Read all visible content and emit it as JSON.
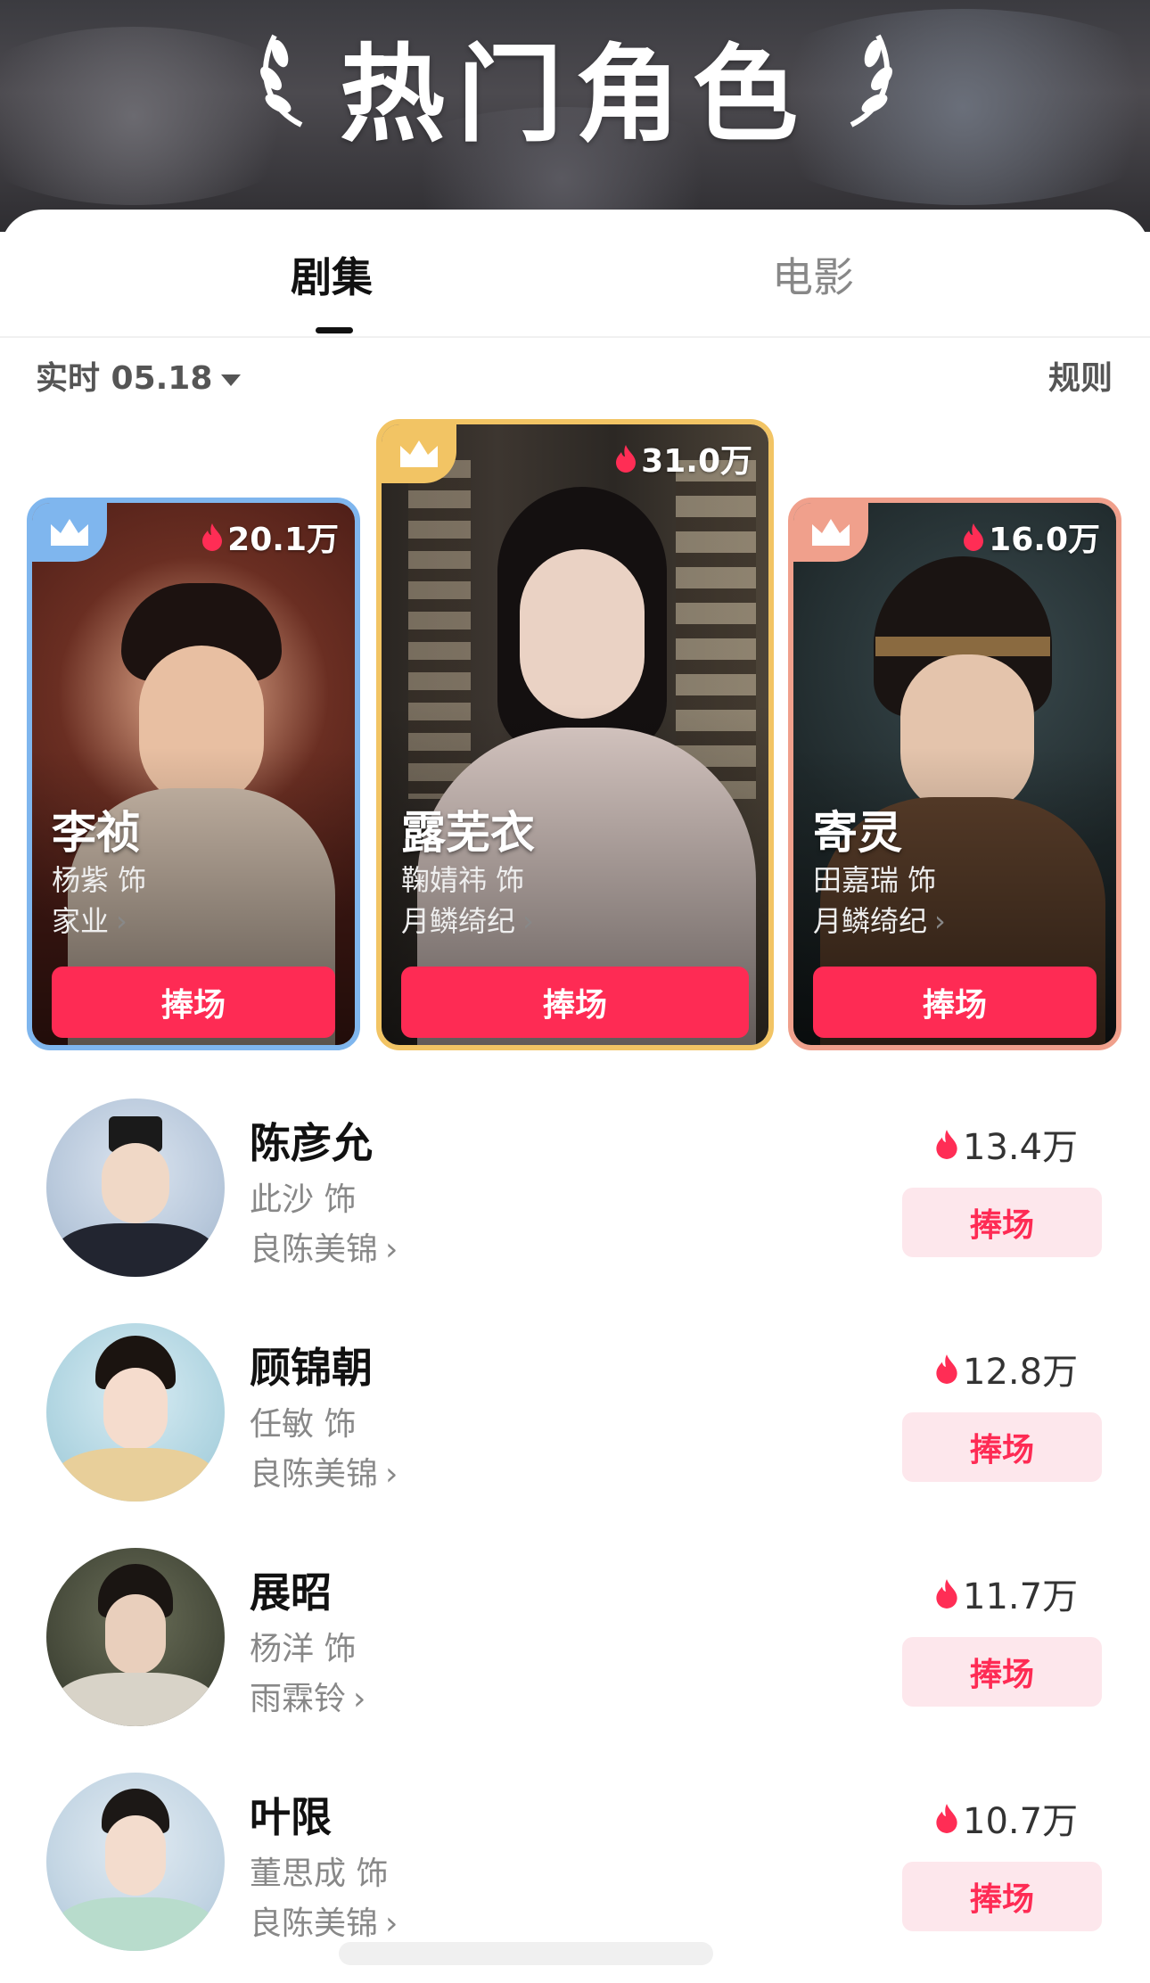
{
  "header": {
    "title": "热门角色"
  },
  "tabs": [
    {
      "label": "剧集"
    },
    {
      "label": "电影"
    }
  ],
  "date_filter": {
    "label": "实时 05.18"
  },
  "rules_label": "规则",
  "top3": [
    {
      "rank_color": "#7fb6ee",
      "heat": "20.1万",
      "character": "李祯",
      "actor": "杨紫 饰",
      "drama": "家业",
      "button": "捧场"
    },
    {
      "rank_color": "#f2c464",
      "heat": "31.0万",
      "character": "露芜衣",
      "actor": "鞠婧祎 饰",
      "drama": "月鳞绮纪",
      "button": "捧场"
    },
    {
      "rank_color": "#f0a08c",
      "heat": "16.0万",
      "character": "寄灵",
      "actor": "田嘉瑞 饰",
      "drama": "月鳞绮纪",
      "button": "捧场"
    }
  ],
  "list": [
    {
      "character": "陈彦允",
      "actor": "此沙 饰",
      "drama": "良陈美锦",
      "heat": "13.4万",
      "button": "捧场"
    },
    {
      "character": "顾锦朝",
      "actor": "任敏 饰",
      "drama": "良陈美锦",
      "heat": "12.8万",
      "button": "捧场"
    },
    {
      "character": "展昭",
      "actor": "杨洋 饰",
      "drama": "雨霖铃",
      "heat": "11.7万",
      "button": "捧场"
    },
    {
      "character": "叶限",
      "actor": "董思成 饰",
      "drama": "良陈美锦",
      "heat": "10.7万",
      "button": "捧场"
    }
  ],
  "chevron": "›"
}
